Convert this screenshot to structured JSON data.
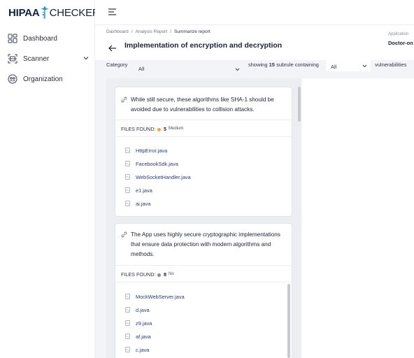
{
  "brand": {
    "part1": "HIPAA",
    "part2": "CHECKER"
  },
  "sidebar": {
    "items": [
      {
        "label": "Dashboard",
        "icon": "dashboard-icon"
      },
      {
        "label": "Scanner",
        "icon": "scanner-icon"
      },
      {
        "label": "Organization",
        "icon": "organization-icon"
      }
    ]
  },
  "breadcrumb": {
    "items": [
      "Dashboard",
      "Analysis Report",
      "Summarize report"
    ]
  },
  "page": {
    "title": "Implementation of encryption and decryption"
  },
  "app_info": {
    "label": "Application",
    "value": "Doctor-on"
  },
  "filters": {
    "category_label": "Category",
    "category_value": "All",
    "showing_prefix": "showing",
    "showing_count": "15",
    "showing_suffix": "subrule containing",
    "severity_value": "All",
    "vulnerabilities_label": "vulnerabilities"
  },
  "cards": [
    {
      "description": "While still secure, these algorithms like SHA-1 should be avoided due to vulnerabilities to collision attacks.",
      "files_label": "FILES FOUND:",
      "count": "5",
      "severity": "Medium",
      "severity_color": "#f0a830",
      "files": [
        "HttpError.java",
        "FacebookSdk.java",
        "WebSocketHandler.java",
        "e1.java",
        "ai.java"
      ]
    },
    {
      "description": "The App uses highly secure cryptographic implementations that ensure data protection with modern algorithms and methods.",
      "files_label": "FILES FOUND:",
      "count": "8",
      "severity": "No",
      "severity_color": "#8a8f9c",
      "files": [
        "MockWebServer.java",
        "d.java",
        "z9.java",
        "af.java",
        "c.java"
      ]
    }
  ],
  "colors": {
    "accent": "#2b3a78",
    "brand_blue": "#1e8fd4"
  }
}
